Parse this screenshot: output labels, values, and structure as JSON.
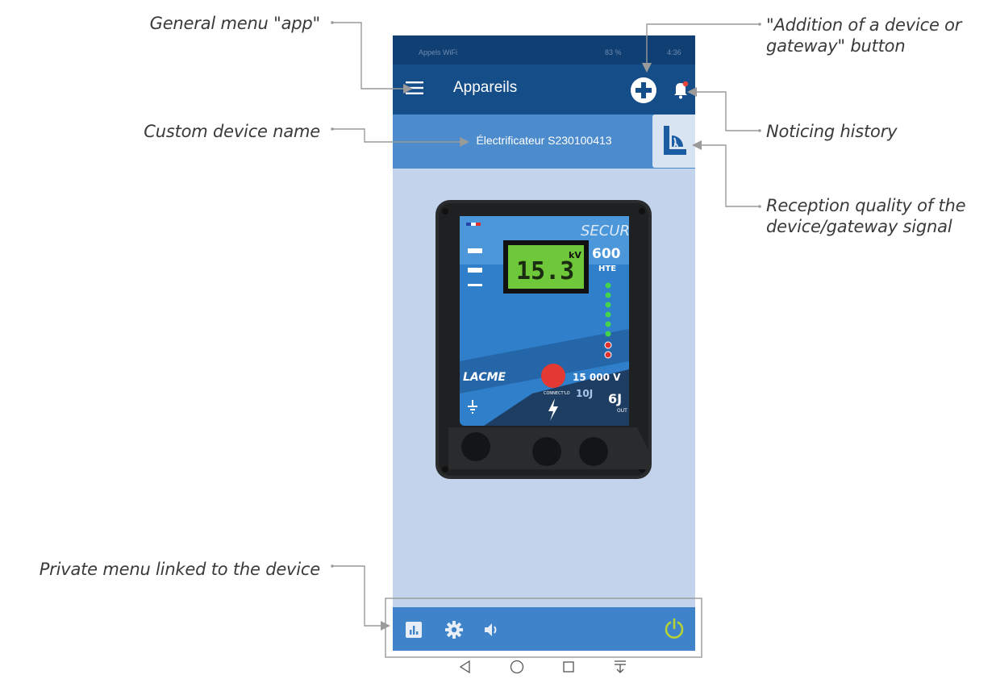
{
  "annotations": {
    "general_menu": "General menu \"app\"",
    "custom_device_name": "Custom device name",
    "private_menu": "Private menu linked to the device",
    "add_device_line1": "\"Addition of a device or",
    "add_device_line2": "gateway\" button",
    "noticing_history": "Noticing history",
    "reception_line1": "Reception quality of the",
    "reception_line2": "device/gateway signal"
  },
  "statusbar": {
    "left_text": "Appels WiFi",
    "right_text": "83 %",
    "time": "4:36"
  },
  "appbar": {
    "title": "Appareils",
    "icons": [
      "menu-icon",
      "add-circle-icon",
      "bell-icon"
    ]
  },
  "device": {
    "name": "Électrificateur S230100413",
    "display_value": "15.3",
    "display_unit": "kV",
    "brand": "SECUR",
    "model": "600",
    "model_suffix": "HTE",
    "maker": "LACME",
    "voltage": "15 000 V",
    "joules_in": "10J",
    "joules_out": "6J",
    "out_label": "OUT",
    "connect_label": "CONNECT'LO"
  },
  "bottom_menu": {
    "icons": [
      "stats-icon",
      "settings-gear-icon",
      "volume-icon",
      "power-icon"
    ]
  },
  "navbar": {
    "icons": [
      "back-icon",
      "home-icon",
      "recents-icon",
      "notification-shade-icon"
    ]
  },
  "colors": {
    "status_bg": "#0f3f73",
    "appbar_bg": "#154d89",
    "device_bar_bg": "#4d8ccc",
    "content_bg": "#c3d3eb",
    "bottom_bar_bg": "#3f84cb",
    "power_green": "#b5d334",
    "lcd_green": "#6fc73a"
  }
}
